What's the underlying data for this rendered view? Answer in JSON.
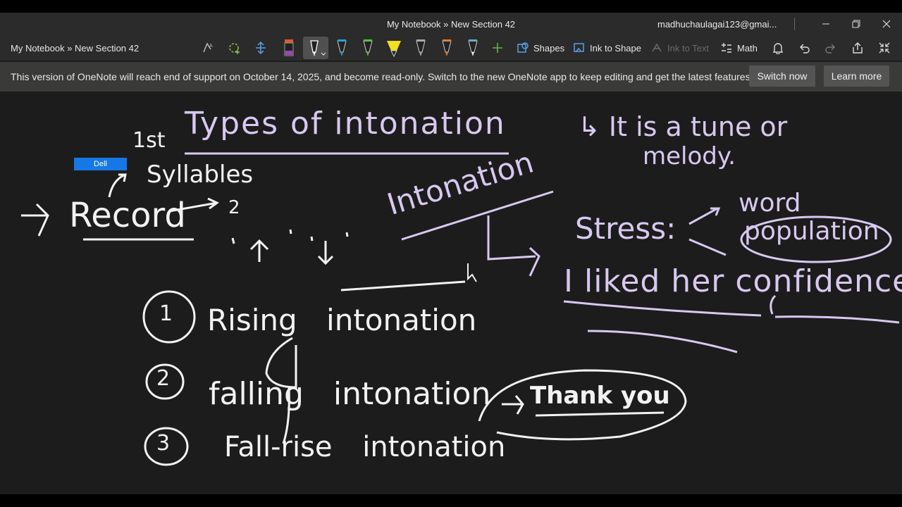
{
  "window": {
    "title": "My Notebook » New Section 42",
    "account": "madhuchaulagai123@gmai..."
  },
  "toolbar": {
    "breadcrumb": "My Notebook » New Section 42",
    "shapes_label": "Shapes",
    "ink_to_shape_label": "Ink to Shape",
    "ink_to_text_label": "Ink to Text",
    "math_label": "Math"
  },
  "notice": {
    "text": "This version of OneNote will reach end of support on October 14, 2025, and become read-only. Switch to the new OneNote app to keep editing and get the latest features.",
    "switch_label": "Switch now",
    "learn_label": "Learn more"
  },
  "page": {
    "heading": "Types of intonation",
    "definition_line1": "↳ It is a tune or",
    "definition_line2": "melody.",
    "syllables_label": "Syllables",
    "first_label": "1st",
    "record_word": "Record",
    "two_label": "2",
    "intonation_word": "Intonation",
    "stress_label": "Stress:",
    "word_label": "word",
    "population_word": "population",
    "example_sentence": "I liked her confidence",
    "item1_num": "1",
    "item1_text": "Rising intonation",
    "item2_num": "2",
    "item2_text": "falling intonation",
    "item3_num": "3",
    "item3_text": "Fall-rise intonation",
    "thank_you": "Thank you",
    "dell_tag": "Dell"
  },
  "colors": {
    "ink_white": "#f2f2f2",
    "ink_lavender": "#d8c8f0",
    "notice_bg": "#3a3a38",
    "toolbar_bg": "#2b2b2b",
    "canvas_bg": "#1c1c1c",
    "dell_tag_bg": "#1677e6"
  }
}
